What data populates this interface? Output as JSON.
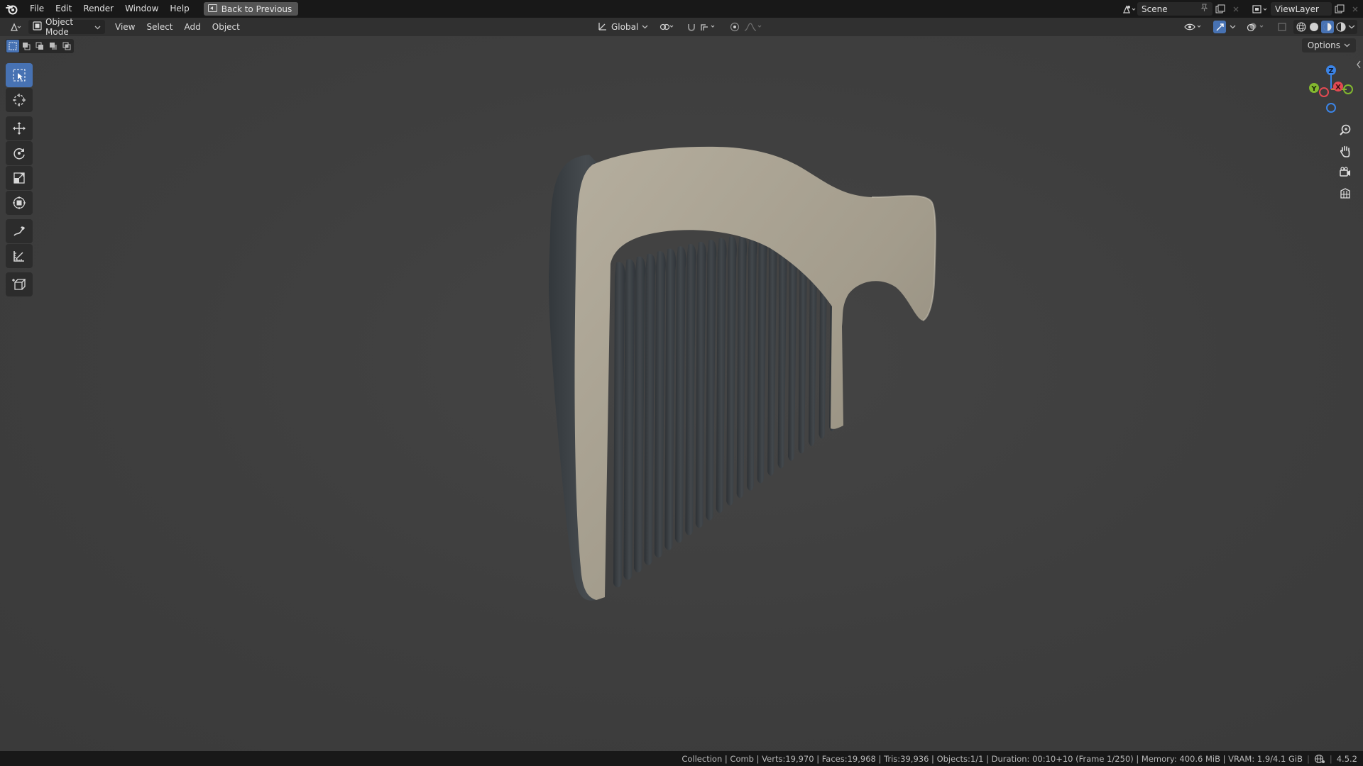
{
  "app": {
    "name": "Blender",
    "logo_icon": "blender-logo-icon"
  },
  "topbar": {
    "menus": [
      "File",
      "Edit",
      "Render",
      "Window",
      "Help"
    ],
    "back_button": "Back to Previous",
    "scene_name": "Scene",
    "view_layer_name": "ViewLayer"
  },
  "header": {
    "mode": "Object Mode",
    "menus": [
      "View",
      "Select",
      "Add",
      "Object"
    ],
    "transform_orientation": "Global",
    "options_label": "Options"
  },
  "gizmo": {
    "axes": {
      "x": "X",
      "y": "Y",
      "z": "Z"
    },
    "colors": {
      "x": "#e34a52",
      "y": "#83b82f",
      "z": "#3b84e6"
    }
  },
  "toolbar": {
    "tools": [
      "select-box",
      "cursor",
      "move",
      "rotate",
      "scale",
      "transform",
      "annotate",
      "measure",
      "add-cube"
    ],
    "active_tool": "select-box"
  },
  "viewport": {
    "object": "Comb",
    "colors": {
      "background": "#3d3d3d",
      "comb_face": "#a49d8e",
      "comb_side": "#3e4347",
      "accent": "#4772b3"
    }
  },
  "statusbar": {
    "text": "Collection | Comb | Verts:19,970 | Faces:19,968 | Tris:39,936 | Objects:1/1 | Duration: 00:10+10 (Frame 1/250) | Memory: 400.6 MiB | VRAM: 1.9/4.1 GiB",
    "version": "4.5.2"
  }
}
